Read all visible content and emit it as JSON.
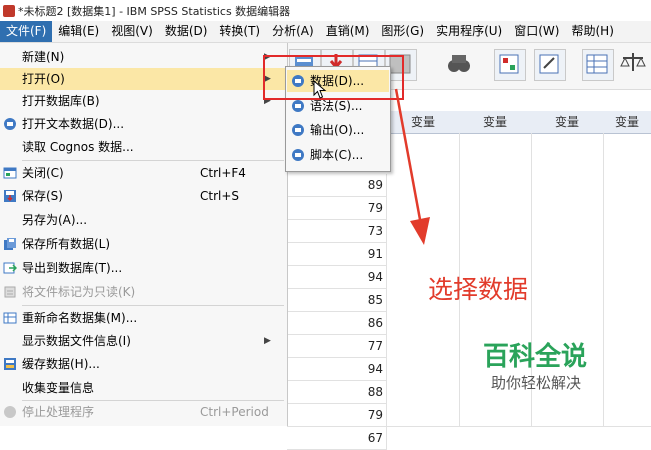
{
  "window": {
    "title": "*未标题2 [数据集1] - IBM SPSS Statistics 数据编辑器"
  },
  "menubar": [
    {
      "label": "文件(F)",
      "active": true
    },
    {
      "label": "编辑(E)"
    },
    {
      "label": "视图(V)"
    },
    {
      "label": "数据(D)"
    },
    {
      "label": "转换(T)"
    },
    {
      "label": "分析(A)"
    },
    {
      "label": "直销(M)"
    },
    {
      "label": "图形(G)"
    },
    {
      "label": "实用程序(U)"
    },
    {
      "label": "窗口(W)"
    },
    {
      "label": "帮助(H)"
    }
  ],
  "file_menu": [
    {
      "label": "新建(N)",
      "submenu": true
    },
    {
      "label": "打开(O)",
      "submenu": true,
      "highlighted": true
    },
    {
      "label": "打开数据库(B)",
      "submenu": true
    },
    {
      "label": "打开文本数据(D)...",
      "icon": "open-text-icon"
    },
    {
      "label": "读取 Cognos 数据..."
    },
    {
      "label": "关闭(C)",
      "shortcut": "Ctrl+F4",
      "icon": "close-window-icon"
    },
    {
      "label": "保存(S)",
      "shortcut": "Ctrl+S",
      "icon": "save-icon"
    },
    {
      "label": "另存为(A)..."
    },
    {
      "label": "保存所有数据(L)",
      "icon": "save-all-icon"
    },
    {
      "label": "导出到数据库(T)...",
      "icon": "export-db-icon"
    },
    {
      "label": "将文件标记为只读(K)",
      "disabled": true,
      "icon": "readonly-icon"
    },
    {
      "label": "重新命名数据集(M)...",
      "icon": "rename-dataset-icon"
    },
    {
      "label": "显示数据文件信息(I)",
      "submenu": true
    },
    {
      "label": "缓存数据(H)...",
      "icon": "cache-data-icon"
    },
    {
      "label": "收集变量信息"
    },
    {
      "label": "停止处理程序",
      "shortcut": "Ctrl+Period",
      "disabled": true,
      "icon": "stop-icon"
    }
  ],
  "open_submenu": [
    {
      "label": "数据(D)...",
      "highlighted": true
    },
    {
      "label": "语法(S)..."
    },
    {
      "label": "输出(O)..."
    },
    {
      "label": "脚本(C)..."
    }
  ],
  "grid": {
    "headers": [
      "变量",
      "变量",
      "变量",
      "变量"
    ],
    "values": [
      "89",
      "79",
      "73",
      "91",
      "94",
      "85",
      "86",
      "77",
      "94",
      "88",
      "79",
      "67"
    ]
  },
  "annotation": "选择数据",
  "watermark": {
    "title": "百科全说",
    "subtitle": "助你轻松解决"
  },
  "colors": {
    "menu_highlight": "#fbe7a6",
    "annotation": "#e23b2b",
    "watermark": "#2aa35a"
  }
}
